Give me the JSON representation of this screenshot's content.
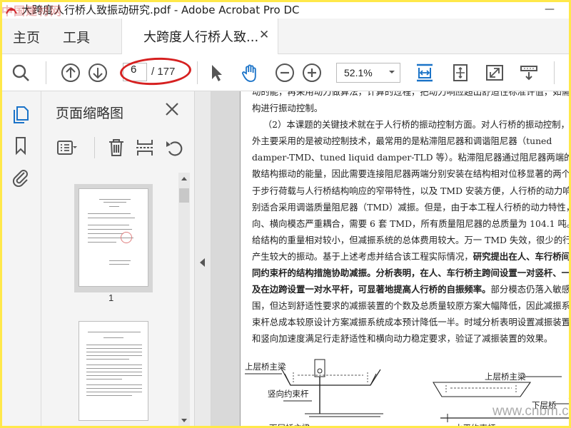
{
  "watermark_text": "中国建材网",
  "window": {
    "title": "大跨度人行桥人致振动研究.pdf - Adobe Acrobat Pro DC",
    "minimize_glyph": "—"
  },
  "menu": {
    "home": "主页",
    "tools": "工具",
    "tab_title": "大跨度人行桥人致...",
    "tab_close": "✕"
  },
  "toolbar": {
    "current_page": "6",
    "total_pages": "/ 177",
    "zoom": "52.1%",
    "icons": [
      "search-icon",
      "prev-page-icon",
      "next-page-icon",
      "select-arrow-icon",
      "hand-icon",
      "zoom-out-icon",
      "zoom-in-icon",
      "fit-width-icon",
      "fit-page-icon",
      "full-screen-icon",
      "read-mode-icon"
    ]
  },
  "rail": {
    "icons": [
      "page-thumbnails-icon",
      "bookmark-icon",
      "attachment-icon"
    ]
  },
  "thumbnails": {
    "title": "页面缩略图",
    "close": "close-icon",
    "tools": [
      "thumbnail-options-icon",
      "delete-icon",
      "insert-page-icon",
      "undo-icon"
    ],
    "page_number": "1",
    "selected_page": 1
  },
  "document": {
    "lines": [
      "动的能，再采用动力做算法，计算的过程，把动力响应超出舒适性标准许值，如需要",
      "构进行振动控制。",
      "    （2）本课题的关键技术就在于人行桥的振动控制方面。对人行桥的振动控制，目前",
      "外主要采用的是被动控制技术，最常用的是粘滞阻尼器和调谐阻尼器（tuned",
      "damper-TMD、tuned liquid damper-TLD 等）。粘滞阻尼器通过阻尼器两端的相对位移",
      "散结构振动的能量，因此需要连接阻尼器两端分别安装在结构相对位移显著的两个点",
      "于步行荷载与人行桥结构响应的窄带特性，以及 TMD 安装方便，人行桥的动力响",
      "别适合采用调谐质量阻尼器（TMD）减振。但是，由于本工程人行桥的动力特性，各",
      "向、横向模态严重耦合，需要 6 套 TMD，所有质量阻尼器的总质量为 104.1 吨。虽然",
      "给结构的重量相对较小，但减振系统的总体费用较大。万一 TMD 失效，很少的行人",
      "产生较大的振动。基于上述考虑并结合该工程实际情况，",
      "同约束杆的结构措施协助减振。分析表明，在人、车行桥主跨间设置一对竖杆、一对",
      "及在边跨设置一对水平杆，可显著地提高人行桥的自振频率。",
      "围，但达到舒适性要求的减振装置的个数及总质量较原方案大幅降低，因此减振系统",
      "束杆总成本较原设计方案减振系统成本预计降低一半。时域分析表明设置减振装置后",
      "和竖向加速度满足行走舒适性和横向动力稳定要求，验证了减振装置的效果。"
    ],
    "line10_bold": "研究提出在人、车行桥间设",
    "line12_tail": "部分模态仍落入敏感频",
    "figure": {
      "label_upper_beam_left": "上层桥主梁",
      "label_vertical_rod": "竖向约束杆",
      "label_upper_beam_right": "上层桥主梁",
      "label_lower_beam": "下层桥",
      "label_bottom_left": "下层桥主梁",
      "label_bottom_mid": "水平约束杆"
    }
  },
  "site_watermark": "www.cnbm.com"
}
